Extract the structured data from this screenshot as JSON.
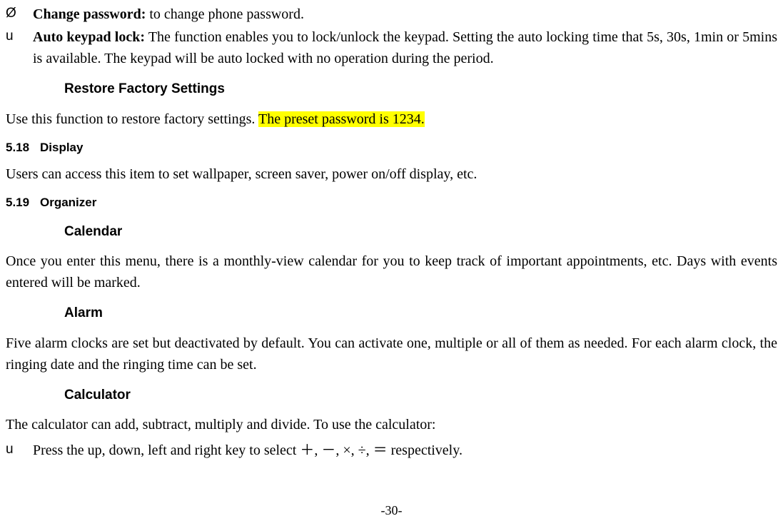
{
  "bullets": {
    "change_password": {
      "marker": "Ø",
      "title": "Change password:",
      "text": " to change phone password."
    },
    "auto_keypad": {
      "marker": "u",
      "title": "Auto keypad lock:",
      "text": " The function enables you to lock/unlock the keypad. Setting the auto locking time that 5s, 30s, 1min or 5mins is available. The keypad will be auto locked with no operation during the period."
    },
    "calc_press": {
      "marker": "u",
      "text": "Press the up, down, left and right key to select ＋, －, ×, ÷, ＝ respectively."
    }
  },
  "headings": {
    "restore": "Restore Factory Settings",
    "display_num": "5.18",
    "display": "Display",
    "organizer_num": "5.19",
    "organizer": "Organizer",
    "calendar": "Calendar",
    "alarm": "Alarm",
    "calculator": "Calculator"
  },
  "paragraphs": {
    "restore_intro": "Use this function to restore factory settings. ",
    "restore_highlight": "The preset password is 1234.",
    "display": "Users can access this item to set wallpaper, screen saver, power on/off display, etc.",
    "calendar": "Once you enter this menu, there is a monthly-view calendar for you to keep track of important appointments, etc. Days with events entered will be marked.",
    "alarm": "Five alarm clocks are set but deactivated by default. You can activate one, multiple or all of them as needed. For each alarm clock, the ringing date and the ringing time can be set.",
    "calculator": "The calculator can add, subtract, multiply and divide. To use the calculator:"
  },
  "page_number": "-30-"
}
